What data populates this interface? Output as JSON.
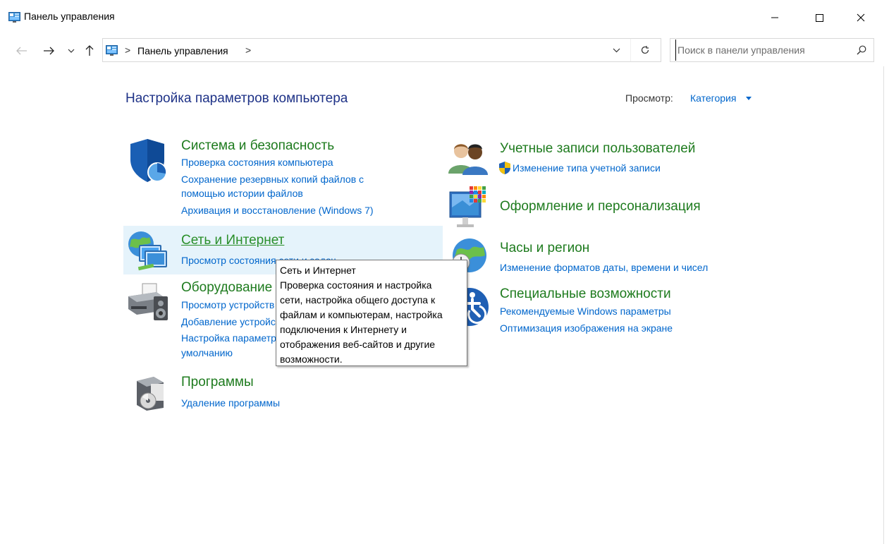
{
  "window": {
    "title": "Панель управления"
  },
  "address_bar": {
    "path": "Панель управления",
    "separator": ">",
    "trailing_separator": ">"
  },
  "search": {
    "placeholder": "Поиск в панели управления"
  },
  "header": {
    "title": "Настройка параметров компьютера",
    "view_label": "Просмотр:",
    "view_value": "Категория"
  },
  "categories": {
    "security": {
      "title": "Система и безопасность",
      "links": [
        "Проверка состояния компьютера",
        "Сохранение резервных копий файлов с",
        "помощью истории файлов",
        "Архивация и восстановление (Windows 7)"
      ]
    },
    "network": {
      "title": "Сеть и Интернет",
      "links": [
        "Просмотр состояния сети и задач"
      ]
    },
    "hardware": {
      "title": "Оборудование и звук",
      "links": [
        "Просмотр устройств и принтеров",
        "Добавление устройства",
        "Настройка параметров по",
        "умолчанию"
      ]
    },
    "programs": {
      "title": "Программы",
      "links": [
        "Удаление программы"
      ]
    },
    "accounts": {
      "title": "Учетные записи пользователей",
      "links": [
        "Изменение типа учетной записи"
      ]
    },
    "appearance": {
      "title": "Оформление и персонализация"
    },
    "clock": {
      "title": "Часы и регион",
      "links": [
        "Изменение форматов даты, времени и чисел"
      ]
    },
    "accessibility": {
      "title": "Специальные возможности",
      "links": [
        "Рекомендуемые Windows параметры",
        "Оптимизация изображения на экране"
      ]
    }
  },
  "tooltip": {
    "title": "Сеть и Интернет",
    "lines": [
      "Проверка состояния и настройка",
      "сети, настройка общего доступа к",
      "файлам и компьютерам, настройка",
      "подключения к Интернету и",
      "отображения веб-сайтов и другие",
      "возможности."
    ]
  },
  "colors": {
    "category_title": "#1e7b1e",
    "link": "#0066cc",
    "page_title": "#1e3287",
    "hover": "#e5f3fb"
  },
  "icons": {
    "title": "control-panel-icon",
    "back": "arrow-left-icon",
    "forward": "arrow-right-icon",
    "recent": "chevron-down-icon",
    "up": "arrow-up-icon",
    "refresh": "refresh-icon",
    "search": "search-icon",
    "minimize": "minimize-icon",
    "maximize": "maximize-icon",
    "close": "close-icon"
  }
}
